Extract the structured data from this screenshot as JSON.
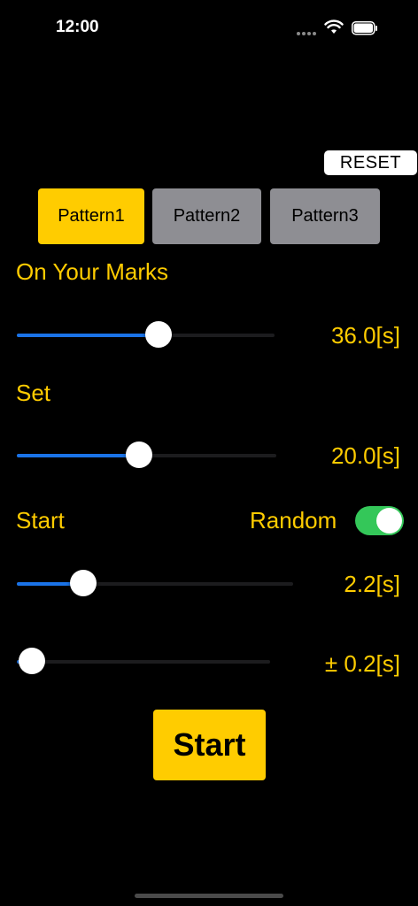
{
  "status_bar": {
    "time": "12:00"
  },
  "reset_label": "RESET",
  "patterns": [
    {
      "label": "Pattern1",
      "selected": true
    },
    {
      "label": "Pattern2",
      "selected": false
    },
    {
      "label": "Pattern3",
      "selected": false
    }
  ],
  "on_your_marks": {
    "label": "On Your Marks",
    "value_text": "36.0[s]",
    "slider_fraction": 0.55
  },
  "set": {
    "label": "Set",
    "value_text": "20.0[s]",
    "slider_fraction": 0.47
  },
  "start_section": {
    "label": "Start",
    "random_label": "Random",
    "random_enabled": true,
    "value_text": "2.2[s]",
    "slider_fraction": 0.24,
    "range_text": "± 0.2[s]",
    "range_slider_fraction": 0.06
  },
  "start_button_label": "Start",
  "colors": {
    "accent": "#ffcc00",
    "slider_fill": "#1a73e8",
    "toggle_on": "#34c759",
    "inactive_button": "#8e8e93"
  }
}
